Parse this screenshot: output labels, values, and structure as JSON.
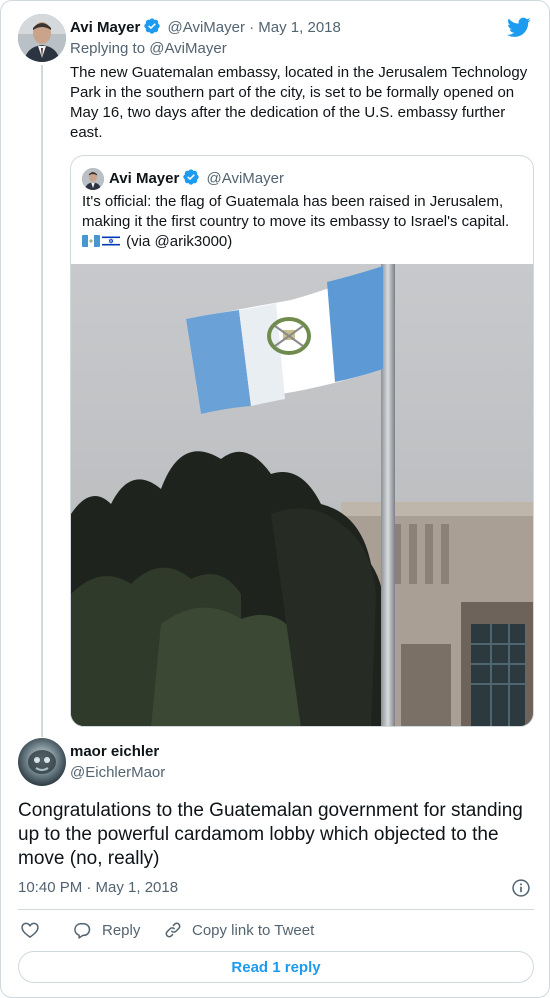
{
  "parent_tweet": {
    "author_name": "Avi Mayer",
    "author_handle": "@AviMayer",
    "separator": "·",
    "date": "May 1, 2018",
    "replying_prefix": "Replying to",
    "replying_to": "@AviMayer",
    "text": "The new Guatemalan embassy, located in the Jerusalem Technology Park in the southern part of the city, is set to be formally opened on May 16, two days after the dedication of the U.S. embassy further east."
  },
  "quoted_tweet": {
    "author_name": "Avi Mayer",
    "author_handle": "@AviMayer",
    "text": "It's official: the flag of Guatemala has been raised in Jerusalem, making it the first country to move its embassy to Israel's capital.",
    "via_text": "(via @arik3000)"
  },
  "main_tweet": {
    "author_name": "maor eichler",
    "author_handle": "@EichlerMaor",
    "text": "Congratulations to the Guatemalan government for standing up to the powerful cardamom lobby which objected to the move (no, really)",
    "timestamp": "10:40 PM · May 1, 2018"
  },
  "actions": {
    "reply_label": "Reply",
    "copy_link_label": "Copy link to Tweet"
  },
  "read_replies_label": "Read 1 reply",
  "colors": {
    "twitter_blue": "#1d9bf0",
    "border": "#cfd9de",
    "muted_text": "#536471",
    "text": "#0f1419"
  }
}
